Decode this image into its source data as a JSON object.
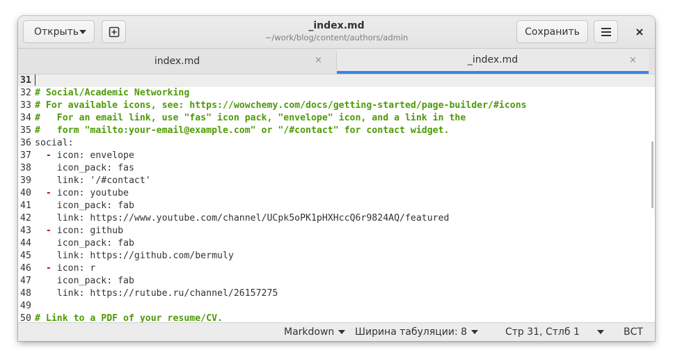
{
  "header": {
    "open_label": "Открыть",
    "title": "_index.md",
    "subtitle": "~/work/blog/content/authors/admin",
    "save_label": "Сохранить",
    "new_icon": "new-document-icon",
    "menu_icon": "hamburger-menu-icon",
    "close_icon": "close-icon"
  },
  "tabs": [
    {
      "label": "index.md",
      "active": false,
      "close": "×"
    },
    {
      "label": "_index.md",
      "active": true,
      "close": "×"
    }
  ],
  "editor": {
    "lines": [
      {
        "n": "31",
        "segments": []
      },
      {
        "n": "32",
        "segments": [
          {
            "t": "c",
            "s": "# Social/Academic Networking"
          }
        ]
      },
      {
        "n": "33",
        "segments": [
          {
            "t": "c",
            "s": "# For available icons, see: https://wowchemy.com/docs/getting-started/page-builder/#icons"
          }
        ]
      },
      {
        "n": "34",
        "segments": [
          {
            "t": "c",
            "s": "#   For an email link, use \"fas\" icon pack, \"envelope\" icon, and a link in the"
          }
        ]
      },
      {
        "n": "35",
        "segments": [
          {
            "t": "c",
            "s": "#   form \"mailto:your-email@example.com\" or \"/#contact\" for contact widget."
          }
        ]
      },
      {
        "n": "36",
        "segments": [
          {
            "t": "n",
            "s": "social:"
          }
        ]
      },
      {
        "n": "37",
        "segments": [
          {
            "t": "n",
            "s": "  "
          },
          {
            "t": "d",
            "s": "-"
          },
          {
            "t": "n",
            "s": " icon: envelope"
          }
        ]
      },
      {
        "n": "38",
        "segments": [
          {
            "t": "n",
            "s": "    icon_pack: fas"
          }
        ]
      },
      {
        "n": "39",
        "segments": [
          {
            "t": "n",
            "s": "    link: '/#contact'"
          }
        ]
      },
      {
        "n": "40",
        "segments": [
          {
            "t": "n",
            "s": "  "
          },
          {
            "t": "d",
            "s": "-"
          },
          {
            "t": "n",
            "s": " icon: youtube"
          }
        ]
      },
      {
        "n": "41",
        "segments": [
          {
            "t": "n",
            "s": "    icon_pack: fab"
          }
        ]
      },
      {
        "n": "42",
        "segments": [
          {
            "t": "n",
            "s": "    link: https://www.youtube.com/channel/UCpk5oPK1pHXHccQ6r9824AQ/featured"
          }
        ]
      },
      {
        "n": "43",
        "segments": [
          {
            "t": "n",
            "s": "  "
          },
          {
            "t": "d",
            "s": "-"
          },
          {
            "t": "n",
            "s": " icon: github"
          }
        ]
      },
      {
        "n": "44",
        "segments": [
          {
            "t": "n",
            "s": "    icon_pack: fab"
          }
        ]
      },
      {
        "n": "45",
        "segments": [
          {
            "t": "n",
            "s": "    link: https://github.com/bermuly"
          }
        ]
      },
      {
        "n": "46",
        "segments": [
          {
            "t": "n",
            "s": "  "
          },
          {
            "t": "d",
            "s": "-"
          },
          {
            "t": "n",
            "s": " icon: r"
          }
        ]
      },
      {
        "n": "47",
        "segments": [
          {
            "t": "n",
            "s": "    icon_pack: fab"
          }
        ]
      },
      {
        "n": "48",
        "segments": [
          {
            "t": "n",
            "s": "    link: https://rutube.ru/channel/26157275"
          }
        ]
      },
      {
        "n": "49",
        "segments": []
      },
      {
        "n": "50",
        "segments": [
          {
            "t": "c",
            "s": "# Link to a PDF of your resume/CV."
          }
        ]
      }
    ],
    "current_line": "31"
  },
  "status": {
    "language": "Markdown",
    "tab_width": "Ширина табуляции: 8",
    "position": "Стр 31, Стлб 1",
    "insert_mode": "ВСТ"
  },
  "colors": {
    "comment": "#4e9a06",
    "dash": "#cc0000",
    "accent": "#3584e4"
  }
}
